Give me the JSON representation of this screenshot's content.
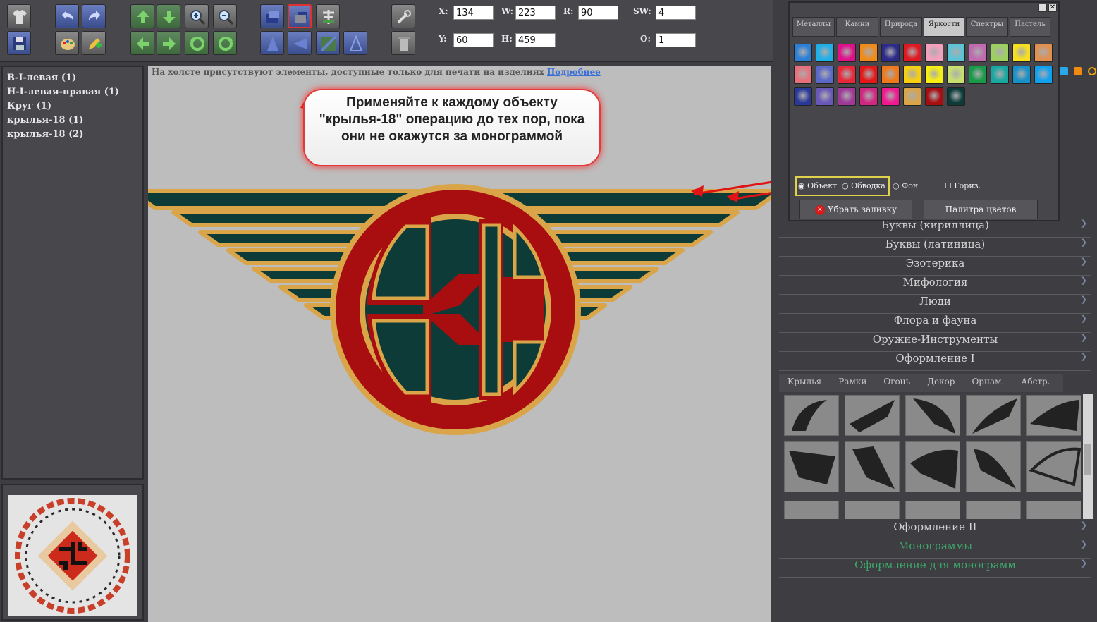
{
  "fields": {
    "x": {
      "label": "X:",
      "value": "134"
    },
    "w": {
      "label": "W:",
      "value": "223"
    },
    "r": {
      "label": "R:",
      "value": "90"
    },
    "sw": {
      "label": "SW:",
      "value": "4"
    },
    "y": {
      "label": "Y:",
      "value": "60"
    },
    "h": {
      "label": "H:",
      "value": "459"
    },
    "o": {
      "label": "O:",
      "value": "1"
    }
  },
  "layers": [
    "В-I-левая (1)",
    "Н-I-левая-правая (1)",
    "Круг (1)",
    "крылья-18 (1)",
    "крылья-18 (2)"
  ],
  "canvas": {
    "notice": "На холсте присутствуют элементы, доступные только для печати на изделиях",
    "notice_link": "Подробнее",
    "callout": "Применяйте к каждому объекту \"крылья-18\" операцию до тех пор, пока они не окажутся за монограммой",
    "colors": {
      "gold": "#d9a548",
      "red": "#a80d10",
      "teal": "#0d3c38",
      "arrow": "#e01414"
    }
  },
  "color_popup": {
    "tabs": [
      "Металлы",
      "Камни",
      "Природа",
      "Яркости",
      "Спектры",
      "Пастель"
    ],
    "active_tab": "Яркости",
    "swatches": [
      "#2a7fd6",
      "#1fb0e8",
      "#e0108a",
      "#f28a1a",
      "#2c2a8a",
      "#e01822",
      "#f4a0bc",
      "#5cc4d6",
      "#c06ab0",
      "#9ed060",
      "#f6e020",
      "#e09050",
      "#e8707a",
      "#5a68c8",
      "#e8283a",
      "#e41818",
      "#f07818",
      "#f8d010",
      "#f8f010",
      "#c8e070",
      "#189a48",
      "#18a8a0",
      "#1890c8",
      "#10a0f0",
      "#2a3898",
      "#6a58b8",
      "#a03898",
      "#d02880",
      "#f01890",
      "#d9a548",
      "#a80d10",
      "#0d3c38"
    ],
    "radio_object": "Объект",
    "radio_stroke": "Обводка",
    "radio_bg": "Фон",
    "check_horiz": "Гориз.",
    "btn_remove_fill": "Убрать заливку",
    "btn_palette": "Палитра цветов"
  },
  "categories": [
    "Буквы (кириллица)",
    "Буквы (латиница)",
    "Эзотерика",
    "Мифология",
    "Люди",
    "Флора и фауна",
    "Оружие-Инструменты",
    "Оформление I"
  ],
  "subtabs": [
    "Крылья",
    "Рамки",
    "Огонь",
    "Декор",
    "Орнам.",
    "Абстр."
  ],
  "categories_bottom": [
    "Оформление II",
    "Монограммы",
    "Оформление для монограмм"
  ]
}
